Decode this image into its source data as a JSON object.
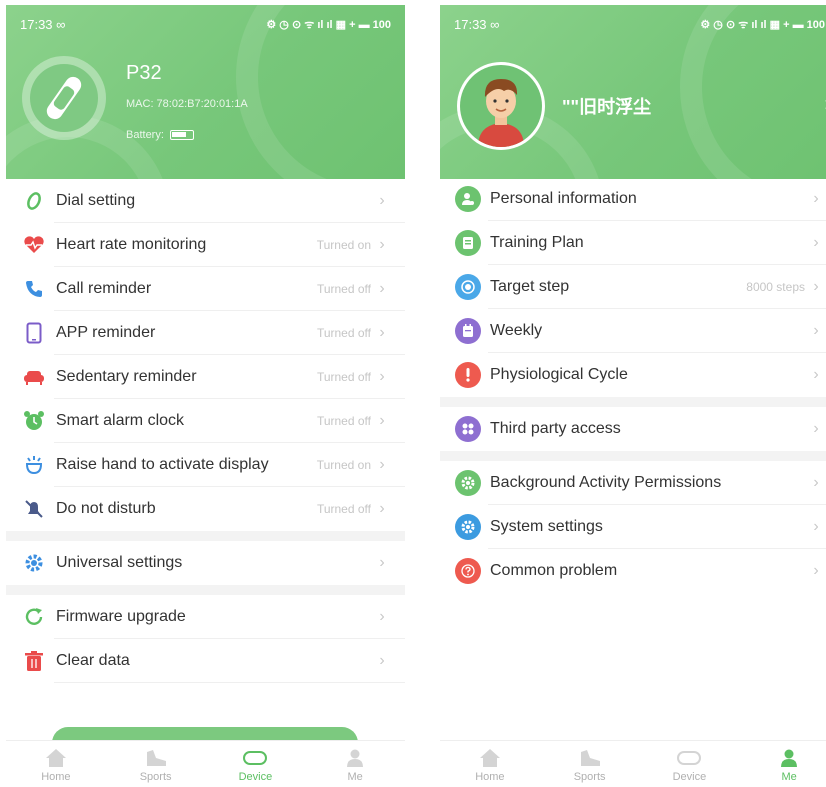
{
  "colors": {
    "accent": "#76c779",
    "active_tab": "#5cbf62",
    "muted": "#c6c6c6"
  },
  "left": {
    "status": {
      "time": "17:33 ∞",
      "icons": "⚙ ◷ ⊙ ᯤ ıl ıl ▦ + ▬ 100"
    },
    "device": {
      "name": "P32",
      "mac": "MAC: 78:02:B7:20:01:1A",
      "battery_label": "Battery:"
    },
    "items": [
      {
        "label": "Dial setting",
        "value": "",
        "icon": "dial-icon"
      },
      {
        "label": "Heart rate monitoring",
        "value": "Turned on",
        "icon": "heart-rate-icon"
      },
      {
        "label": "Call reminder",
        "value": "Turned off",
        "icon": "phone-icon"
      },
      {
        "label": "APP reminder",
        "value": "Turned off",
        "icon": "app-icon"
      },
      {
        "label": "Sedentary reminder",
        "value": "Turned off",
        "icon": "sofa-icon"
      },
      {
        "label": "Smart alarm clock",
        "value": "Turned off",
        "icon": "alarm-icon"
      },
      {
        "label": "Raise hand to activate display",
        "value": "Turned on",
        "icon": "raise-hand-icon"
      },
      {
        "label": "Do not disturb",
        "value": "Turned off",
        "icon": "do-not-disturb-icon"
      }
    ],
    "settings_item": {
      "label": "Universal settings",
      "icon": "gear-icon"
    },
    "maint_items": [
      {
        "label": "Firmware upgrade",
        "icon": "refresh-icon"
      },
      {
        "label": "Clear data",
        "icon": "trash-icon"
      }
    ]
  },
  "right": {
    "status": {
      "time": "17:33 ∞",
      "icons": "⚙ ◷ ⊙ ᯤ ıl ıl ▦ + ▬ 100"
    },
    "user": {
      "name": "\"\"旧时浮尘"
    },
    "items": [
      {
        "label": "Personal information",
        "value": "",
        "icon": "person-icon",
        "color": "#6cc36f"
      },
      {
        "label": "Training Plan",
        "value": "",
        "icon": "plan-icon",
        "color": "#6cc36f"
      },
      {
        "label": "Target step",
        "value": "8000 steps",
        "icon": "target-icon",
        "color": "#4aa8e8"
      },
      {
        "label": "Weekly",
        "value": "",
        "icon": "calendar-icon",
        "color": "#8e6fd1"
      },
      {
        "label": "Physiological Cycle",
        "value": "",
        "icon": "alert-icon",
        "color": "#ee5a4f"
      }
    ],
    "third_party": {
      "label": "Third party access",
      "icon": "apps-icon",
      "color": "#8e6fd1"
    },
    "system_items": [
      {
        "label": "Background Activity Permissions",
        "icon": "gear-icon",
        "color": "#6cc36f"
      },
      {
        "label": "System settings",
        "icon": "settings-icon",
        "color": "#3c9be0"
      },
      {
        "label": "Common problem",
        "icon": "help-icon",
        "color": "#ee5a4f"
      }
    ]
  },
  "tabs": [
    {
      "label": "Home",
      "icon": "home-icon"
    },
    {
      "label": "Sports",
      "icon": "shoe-icon"
    },
    {
      "label": "Device",
      "icon": "watch-icon"
    },
    {
      "label": "Me",
      "icon": "user-icon"
    }
  ]
}
